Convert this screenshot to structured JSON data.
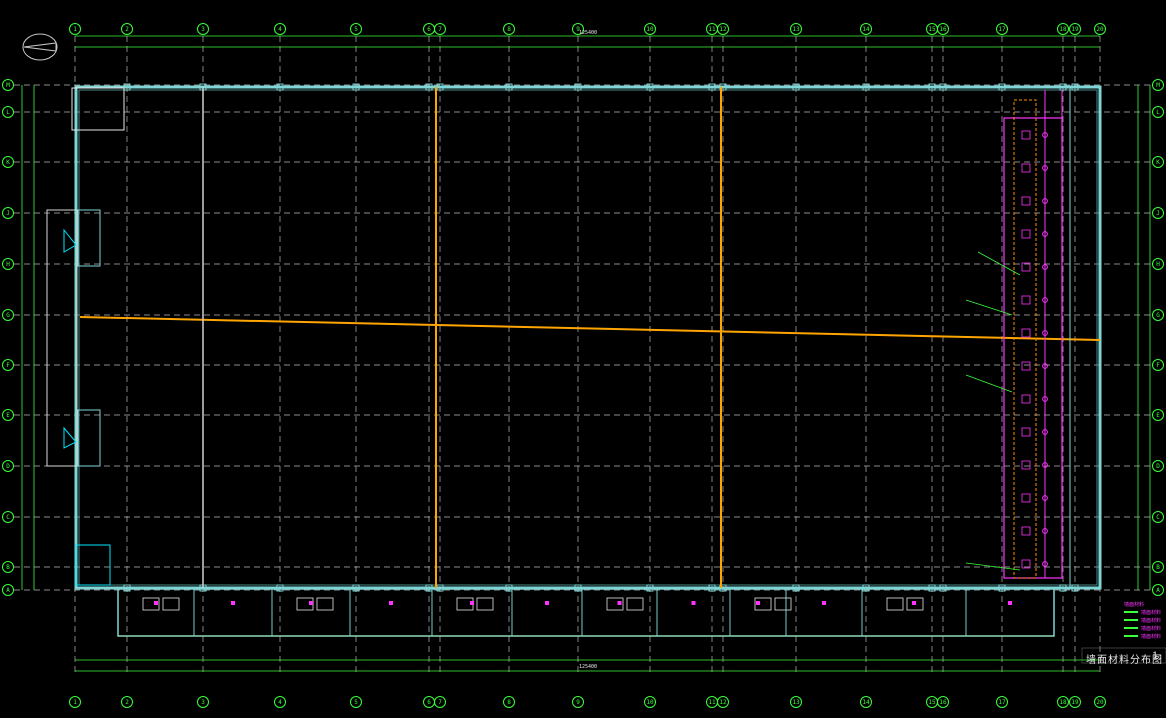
{
  "drawing": {
    "title": "墙面材料分布图",
    "scale": "1:",
    "top_total_dim": "125400",
    "bottom_total_dim": "125400"
  },
  "grid": {
    "columns": [
      "1",
      "2",
      "3",
      "4",
      "5",
      "6",
      "7",
      "8",
      "9",
      "10",
      "11",
      "12",
      "13",
      "14",
      "15",
      "16",
      "17",
      "18",
      "19",
      "20"
    ],
    "rows": [
      "M",
      "L",
      "K",
      "J",
      "H",
      "G",
      "F",
      "E",
      "D",
      "C",
      "B",
      "A"
    ]
  },
  "colors": {
    "grid_axis": "#3aff3a",
    "wall": "#7fd6d6",
    "dash": "#b8b8b8",
    "orange": "#ffa500",
    "magenta": "#ff33ff",
    "bubble": "#3aff3a"
  },
  "legend": {
    "heading": "墙面材料",
    "items": [
      "墙面材料",
      "墙面材料",
      "墙面材料",
      "墙面材料"
    ]
  }
}
